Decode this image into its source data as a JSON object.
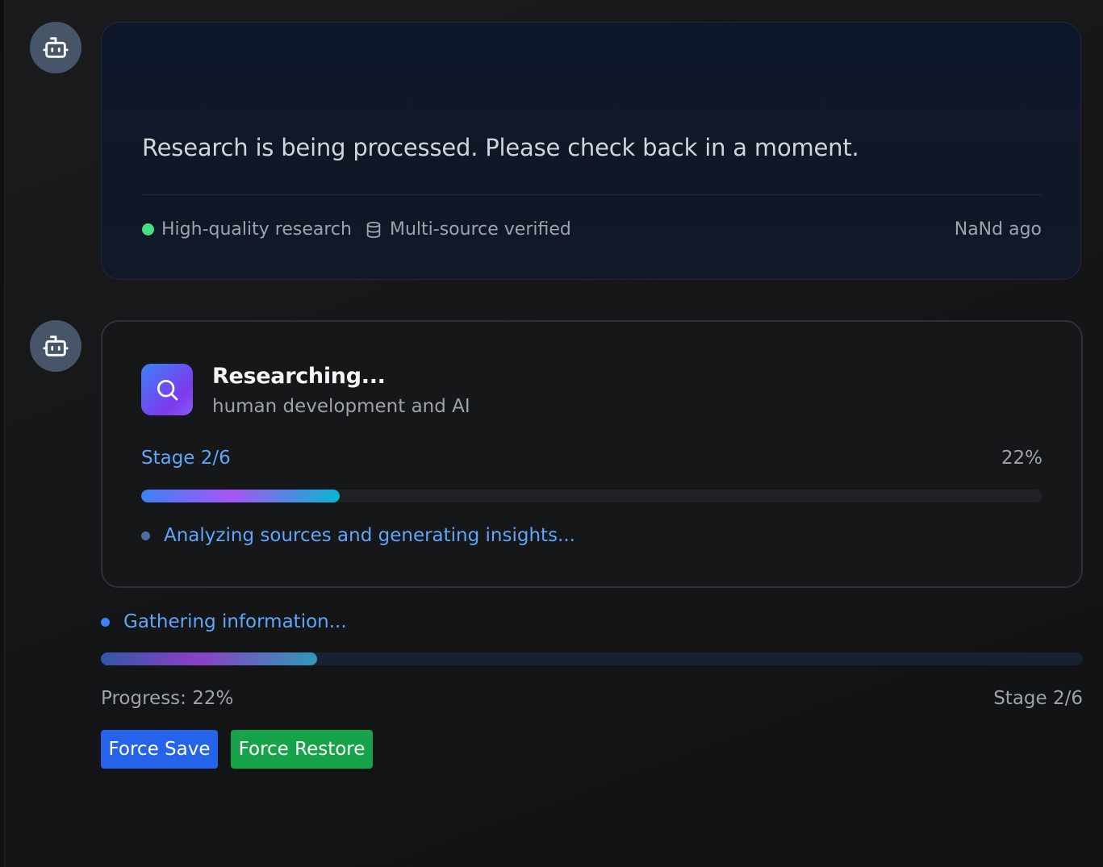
{
  "status_card": {
    "message": "Research is being processed. Please check back in a moment.",
    "badge_quality": "High-quality research",
    "badge_sources": "Multi-source verified",
    "time_ago": "NaNd ago"
  },
  "progress_card": {
    "title": "Researching...",
    "query": "human development and AI",
    "stage": "Stage 2/6",
    "percent_label": "22%",
    "progress": 0.22,
    "current_step": "Analyzing sources and generating insights..."
  },
  "footer": {
    "gather_status": "Gathering information...",
    "progress": 0.22,
    "progress_text": "Progress: 22%",
    "stage_text": "Stage 2/6"
  },
  "buttons": {
    "save_label": "Force Save",
    "restore_label": "Force Restore"
  },
  "colors": {
    "accent_blue": "#60a5fa",
    "success_green": "#4ade80",
    "save_button": "#2563eb",
    "restore_button": "#16a34a"
  },
  "icons": {
    "assistant_avatar": "bot-icon",
    "sources_badge": "database-icon",
    "research_tile": "search-icon"
  }
}
